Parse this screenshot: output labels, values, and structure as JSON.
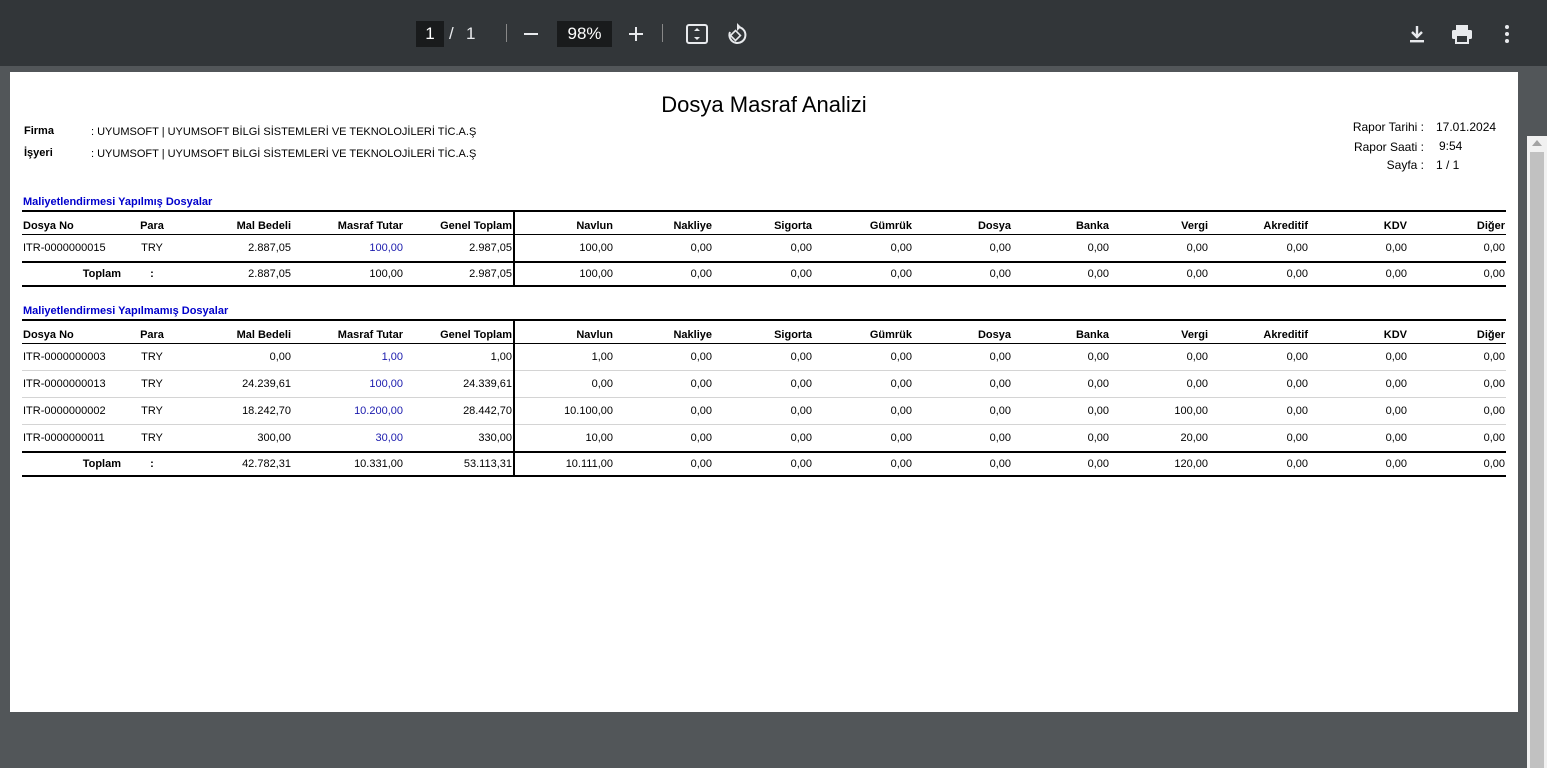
{
  "toolbar": {
    "page_current": "1",
    "page_separator": "/",
    "page_total": "1",
    "zoom": "98%"
  },
  "report": {
    "title": "Dosya Masraf Analizi",
    "firma_label": "Firma",
    "firma_value": ": UYUMSOFT | UYUMSOFT BİLGİ SİSTEMLERİ VE TEKNOLOJİLERİ TİC.A.Ş",
    "isyeri_label": "İşyeri",
    "isyeri_value": ": UYUMSOFT | UYUMSOFT BİLGİ SİSTEMLERİ VE TEKNOLOJİLERİ TİC.A.Ş",
    "rapor_tarihi_label": "Rapor Tarihi  :",
    "rapor_tarihi_value": "17.01.2024",
    "rapor_saati_label": "Rapor Saati  :",
    "rapor_saati_value": "9:54",
    "sayfa_label": "Sayfa  :",
    "sayfa_value": "1 / 1"
  },
  "columns": [
    "Dosya No",
    "Para",
    "Mal Bedeli",
    "Masraf Tutar",
    "Genel Toplam",
    "Navlun",
    "Nakliye",
    "Sigorta",
    "Gümrük",
    "Dosya",
    "Banka",
    "Vergi",
    "Akreditif",
    "KDV",
    "Diğer"
  ],
  "sections": [
    {
      "title": "Maliyetlendirmesi Yapılmış Dosyalar",
      "rows": [
        [
          "ITR-0000000015",
          "TRY",
          "2.887,05",
          "100,00",
          "2.987,05",
          "100,00",
          "0,00",
          "0,00",
          "0,00",
          "0,00",
          "0,00",
          "0,00",
          "0,00",
          "0,00",
          "0,00"
        ]
      ],
      "total": [
        "Toplam",
        ":",
        "2.887,05",
        "100,00",
        "2.987,05",
        "100,00",
        "0,00",
        "0,00",
        "0,00",
        "0,00",
        "0,00",
        "0,00",
        "0,00",
        "0,00",
        "0,00"
      ]
    },
    {
      "title": "Maliyetlendirmesi Yapılmamış Dosyalar",
      "rows": [
        [
          "ITR-0000000003",
          "TRY",
          "0,00",
          "1,00",
          "1,00",
          "1,00",
          "0,00",
          "0,00",
          "0,00",
          "0,00",
          "0,00",
          "0,00",
          "0,00",
          "0,00",
          "0,00"
        ],
        [
          "ITR-0000000013",
          "TRY",
          "24.239,61",
          "100,00",
          "24.339,61",
          "0,00",
          "0,00",
          "0,00",
          "0,00",
          "0,00",
          "0,00",
          "0,00",
          "0,00",
          "0,00",
          "0,00"
        ],
        [
          "ITR-0000000002",
          "TRY",
          "18.242,70",
          "10.200,00",
          "28.442,70",
          "10.100,00",
          "0,00",
          "0,00",
          "0,00",
          "0,00",
          "0,00",
          "100,00",
          "0,00",
          "0,00",
          "0,00"
        ],
        [
          "ITR-0000000011",
          "TRY",
          "300,00",
          "30,00",
          "330,00",
          "10,00",
          "0,00",
          "0,00",
          "0,00",
          "0,00",
          "0,00",
          "20,00",
          "0,00",
          "0,00",
          "0,00"
        ]
      ],
      "total": [
        "Toplam",
        ":",
        "42.782,31",
        "10.331,00",
        "53.113,31",
        "10.111,00",
        "0,00",
        "0,00",
        "0,00",
        "0,00",
        "0,00",
        "120,00",
        "0,00",
        "0,00",
        "0,00"
      ]
    }
  ],
  "colors": {
    "toolbar_bg": "#323639",
    "viewer_bg": "#525659",
    "link_blue": "#1a1aad",
    "section_blue": "#0000cc"
  },
  "icons": [
    "minus-icon",
    "plus-icon",
    "fit-page-icon",
    "rotate-icon",
    "download-icon",
    "print-icon",
    "more-vert-icon"
  ]
}
